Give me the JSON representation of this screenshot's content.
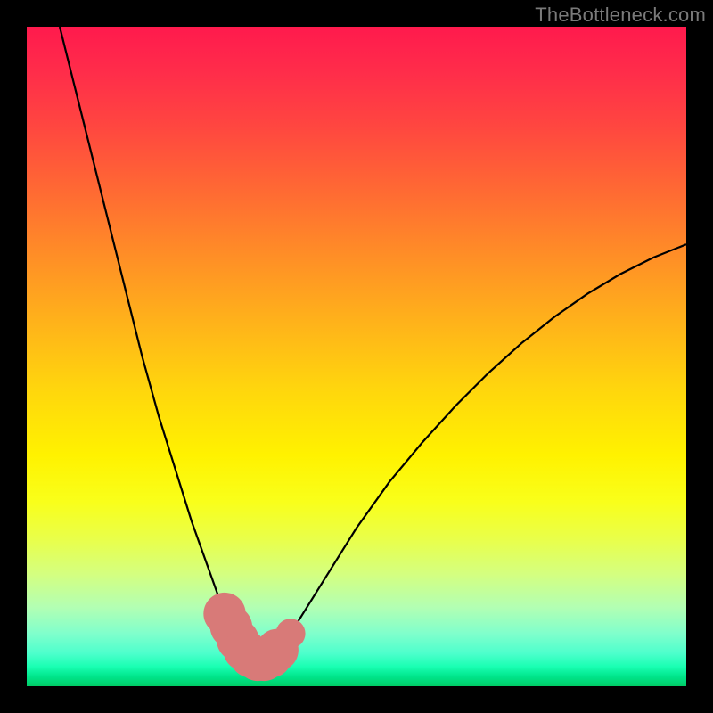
{
  "watermark": "TheBottleneck.com",
  "chart_data": {
    "type": "line",
    "title": "",
    "xlabel": "",
    "ylabel": "",
    "xlim": [
      0,
      100
    ],
    "ylim": [
      0,
      100
    ],
    "grid": false,
    "legend": false,
    "series": [
      {
        "name": "bottleneck-curve",
        "x": [
          5,
          7.5,
          10,
          12.5,
          15,
          17.5,
          20,
          22.5,
          25,
          27.5,
          30,
          31,
          32,
          33,
          34,
          35,
          36,
          37,
          38,
          40,
          42.5,
          45,
          50,
          55,
          60,
          65,
          70,
          75,
          80,
          85,
          90,
          95,
          100
        ],
        "values": [
          100,
          90,
          80,
          70,
          60,
          50,
          41,
          33,
          25,
          18,
          11,
          9,
          7,
          5.5,
          4.5,
          4,
          4,
          4.5,
          5.5,
          8,
          12,
          16,
          24,
          31,
          37,
          42.5,
          47.5,
          52,
          56,
          59.5,
          62.5,
          65,
          67
        ]
      }
    ],
    "markers": {
      "name": "highlight-dots",
      "color": "#d87a78",
      "points": [
        {
          "x": 30,
          "y": 11,
          "r": 2.0
        },
        {
          "x": 31,
          "y": 9,
          "r": 2.0
        },
        {
          "x": 32,
          "y": 7,
          "r": 2.0
        },
        {
          "x": 33,
          "y": 5.5,
          "r": 2.0
        },
        {
          "x": 34,
          "y": 4.5,
          "r": 2.0
        },
        {
          "x": 35,
          "y": 4,
          "r": 2.0
        },
        {
          "x": 36,
          "y": 4,
          "r": 2.0
        },
        {
          "x": 37,
          "y": 4.5,
          "r": 2.0
        },
        {
          "x": 38,
          "y": 5.5,
          "r": 2.0
        },
        {
          "x": 40,
          "y": 8,
          "r": 1.4
        }
      ]
    },
    "gradient_stops": [
      {
        "pos": 0,
        "color": "#ff1a4d"
      },
      {
        "pos": 0.25,
        "color": "#ff6a33"
      },
      {
        "pos": 0.55,
        "color": "#ffd60d"
      },
      {
        "pos": 0.78,
        "color": "#e8ff4d"
      },
      {
        "pos": 0.92,
        "color": "#80ffcc"
      },
      {
        "pos": 1.0,
        "color": "#00cc66"
      }
    ]
  }
}
